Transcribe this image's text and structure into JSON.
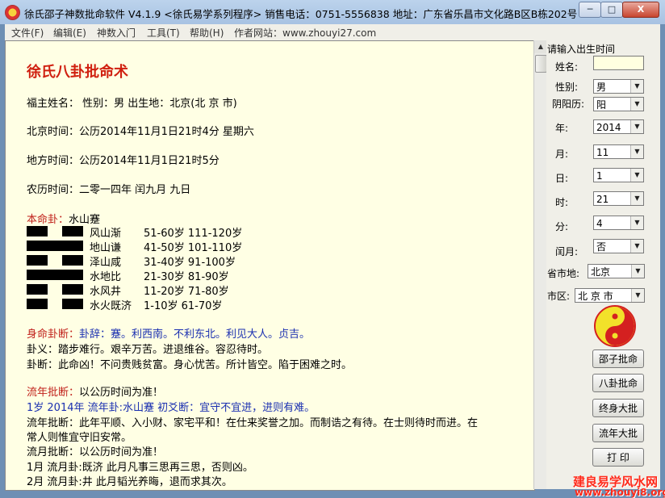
{
  "window": {
    "title": "徐氏邵子神数批命软件 V4.1.9 <徐氏易学系列程序>    销售电话：0751-5556838    地址：广东省乐昌市文化路B区B栋202号",
    "min_label": "─",
    "max_label": "□",
    "close_label": "X"
  },
  "menu": {
    "file": "文件(F)",
    "edit": "编辑(E)",
    "intro": "神数入门",
    "tools": "工具(T)",
    "help": "帮助(H)",
    "website": "作者网站：www.zhouyi27.com"
  },
  "report": {
    "heading": "徐氏八卦批命术",
    "client_line": "福主姓名：  性别：男  出生地：北京(北 京 市)",
    "beijing_time": "北京时间：公历2014年11月1日21时4分 星期六",
    "local_time": "地方时间：公历2014年11月1日21时5分",
    "lunar_time": "农历时间：二零一四年 闰九月 九日",
    "ben_ming_label": "本命卦：",
    "ben_ming_value": "水山蹇",
    "hexagrams": [
      {
        "name": "风山渐",
        "ages": "51-60岁  111-120岁",
        "pattern": [
          0,
          0
        ]
      },
      {
        "name": "地山谦",
        "ages": "41-50岁  101-110岁",
        "pattern": [
          1
        ]
      },
      {
        "name": "泽山咸",
        "ages": "31-40岁  91-100岁",
        "pattern": [
          0,
          0
        ]
      },
      {
        "name": "水地比",
        "ages": "21-30岁  81-90岁",
        "pattern": [
          1
        ]
      },
      {
        "name": "水风井",
        "ages": "11-20岁  71-80岁",
        "pattern": [
          0,
          0
        ]
      },
      {
        "name": "水火既济",
        "ages": "1-10岁   61-70岁",
        "pattern": [
          0,
          0
        ]
      }
    ],
    "shen_ming_label": "身命卦断：",
    "shen_ming_value": "卦辞：蹇。利西南。不利东北。利见大人。贞吉。",
    "gua_yi": "卦义：踏步难行。艰辛万苦。进退维谷。容忍待时。",
    "gua_duan": "卦断：此命凶！不问贵贱贫富。身心忧苦。所计皆空。陷于困难之时。",
    "liu_nian_title_label": "流年批断：",
    "liu_nian_title_value": "以公历时间为准！",
    "liu_nian_first": "1岁  2014年  流年卦:水山蹇  初爻断：宜守不宜进，进则有难。",
    "liu_nian_detail_1": "流年批断：此年平顺、入小财、家宅平和！在仕来奖誉之加。而制诰之有待。在士则待时而进。在",
    "liu_nian_detail_2": "常人则惟宜守旧安常。",
    "liu_yue_title": "流月批断：以公历时间为准！",
    "month_1": "1月  流月卦:既济  此月凡事三思再三思，否则凶。",
    "month_2": "2月  流月卦:井    此月韬光养晦，退而求其次。"
  },
  "side": {
    "prompt": "请输入出生时间",
    "name_label": "姓名:",
    "name_value": "",
    "gender_label": "性别:",
    "gender_value": "男",
    "calendar_label": "阴阳历:",
    "calendar_value": "阳",
    "year_label": "年:",
    "year_value": "2014",
    "month_label": "月:",
    "month_value": "11",
    "day_label": "日:",
    "day_value": "1",
    "hour_label": "时:",
    "hour_value": "21",
    "minute_label": "分:",
    "minute_value": "4",
    "leap_label": "闰月:",
    "leap_value": "否",
    "province_label": "省市地:",
    "province_value": "北京",
    "district_label": "市区:",
    "district_value": "北 京 市",
    "buttons": {
      "shaozi": "邵子批命",
      "bagua": "八卦批命",
      "lifetime": "终身大批",
      "yearly": "流年大批",
      "print": "打 印"
    }
  },
  "watermark": {
    "line1": "建良易学风水网",
    "line2": "www.zhouyi8.org"
  },
  "colors": {
    "report_background": "#ffffe4",
    "heading_red": "#d02010",
    "label_red": "#c0201a",
    "label_blue": "#1a2fb0"
  }
}
